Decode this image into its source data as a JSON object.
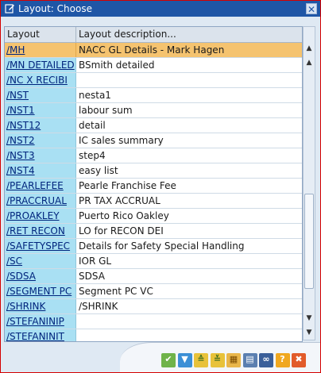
{
  "window": {
    "title": "Layout: Choose",
    "close_glyph": "✕"
  },
  "table": {
    "headers": [
      "Layout",
      "Layout description..."
    ],
    "rows": [
      {
        "layout": "/MH",
        "description": "NACC GL Details - Mark Hagen",
        "selected": true
      },
      {
        "layout": "/MN DETAILED",
        "description": "BSmith detailed"
      },
      {
        "layout": "/NC X RECIBI",
        "description": ""
      },
      {
        "layout": "/NST",
        "description": "nesta1"
      },
      {
        "layout": "/NST1",
        "description": "labour sum"
      },
      {
        "layout": "/NST12",
        "description": "detail"
      },
      {
        "layout": "/NST2",
        "description": "IC sales summary"
      },
      {
        "layout": "/NST3",
        "description": "step4"
      },
      {
        "layout": "/NST4",
        "description": "easy list"
      },
      {
        "layout": "/PEARLEFEE",
        "description": "Pearle Franchise Fee"
      },
      {
        "layout": "/PRACCRUAL",
        "description": "PR TAX ACCRUAL"
      },
      {
        "layout": "/PROAKLEY",
        "description": "Puerto Rico Oakley"
      },
      {
        "layout": "/RET RECON",
        "description": "LO for RECON DEI"
      },
      {
        "layout": "/SAFETYSPEC",
        "description": "Details for Safety Special Handling"
      },
      {
        "layout": "/SC",
        "description": "IOR GL"
      },
      {
        "layout": "/SDSA",
        "description": "SDSA"
      },
      {
        "layout": "/SEGMENT PC",
        "description": "Segment PC VC"
      },
      {
        "layout": "/SHRINK",
        "description": "/SHRINK"
      },
      {
        "layout": "/STEFANINIP",
        "description": ""
      },
      {
        "layout": "/STEFANINIT",
        "description": ""
      }
    ]
  },
  "scrollbar": {
    "up_glyph": "▲",
    "down_glyph": "▼"
  },
  "toolbar": [
    {
      "name": "continue-button",
      "icon": "check-icon",
      "glyph": "✔",
      "bg": "#6fb34a",
      "fg": "#ffffff"
    },
    {
      "name": "filter-button",
      "icon": "filter-icon",
      "glyph": "▼",
      "bg": "#3b8fd6",
      "fg": "#ffffff"
    },
    {
      "name": "sort-ascending-button",
      "icon": "sort-ascending-icon",
      "glyph": "≙",
      "bg": "#e8c23a",
      "fg": "#3a6b1e"
    },
    {
      "name": "sort-descending-button",
      "icon": "sort-descending-icon",
      "glyph": "≚",
      "bg": "#e8c23a",
      "fg": "#3a6b1e"
    },
    {
      "name": "table-view-button",
      "icon": "grid-icon",
      "glyph": "▦",
      "bg": "#e9b64a",
      "fg": "#7a4a00"
    },
    {
      "name": "print-button",
      "icon": "printer-icon",
      "glyph": "▤",
      "bg": "#5b7fb0",
      "fg": "#ffffff"
    },
    {
      "name": "find-button",
      "icon": "binoculars-icon",
      "glyph": "∞",
      "bg": "#3a5f9a",
      "fg": "#ffffff"
    },
    {
      "name": "help-button",
      "icon": "help-icon",
      "glyph": "?",
      "bg": "#f0a820",
      "fg": "#ffffff"
    },
    {
      "name": "cancel-button",
      "icon": "close-icon",
      "glyph": "✖",
      "bg": "#e25b2a",
      "fg": "#ffffff"
    }
  ]
}
